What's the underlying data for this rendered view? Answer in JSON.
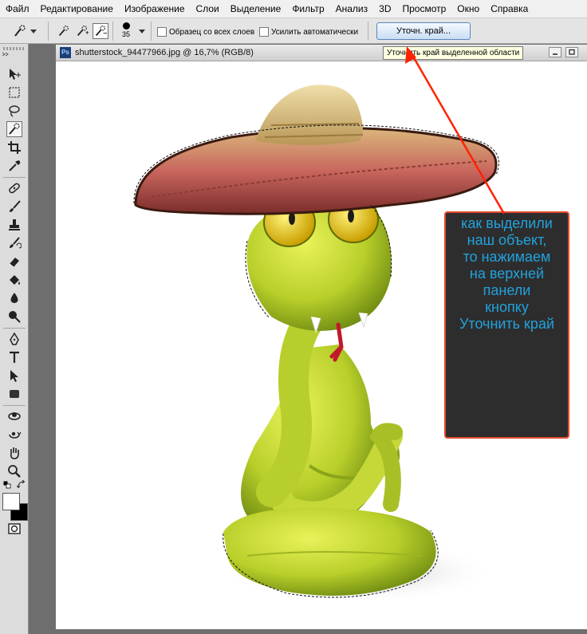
{
  "menu": {
    "items": [
      "Файл",
      "Редактирование",
      "Изображение",
      "Слои",
      "Выделение",
      "Фильтр",
      "Анализ",
      "3D",
      "Просмотр",
      "Окно",
      "Справка"
    ]
  },
  "options": {
    "brush_size": "35",
    "sample_all_layers": "Образец со всех слоев",
    "auto_enhance": "Усилить автоматически",
    "refine_edge_button": "Уточн. край...",
    "tooltip": "Уточнить край выделенной области"
  },
  "document": {
    "title": "shutterstock_94477966.jpg @ 16,7% (RGB/8)",
    "app_badge": "Ps"
  },
  "annotation": {
    "lines": [
      "как выделили",
      "наш объект,",
      "то нажимаем",
      "на верхней",
      "панели",
      "кнопку",
      "Уточнить край"
    ],
    "text_color": "#22a2dc",
    "border_color": "#e84a2d",
    "arrow_color": "#ff2200"
  },
  "toolbox": {
    "tools": [
      "move-tool-icon",
      "marquee-tool-icon",
      "lasso-tool-icon",
      "quick-selection-tool-icon",
      "crop-tool-icon",
      "eyedropper-tool-icon",
      "healing-brush-tool-icon",
      "brush-tool-icon",
      "clone-stamp-tool-icon",
      "history-brush-tool-icon",
      "eraser-tool-icon",
      "paint-bucket-tool-icon",
      "blur-tool-icon",
      "dodge-tool-icon",
      "pen-tool-icon",
      "type-tool-icon",
      "path-selection-tool-icon",
      "rectangle-tool-icon",
      "3d-rotate-tool-icon",
      "3d-orbit-tool-icon",
      "hand-tool-icon",
      "zoom-tool-icon"
    ],
    "foreground_color": "#ffffff",
    "background_color": "#000000"
  }
}
